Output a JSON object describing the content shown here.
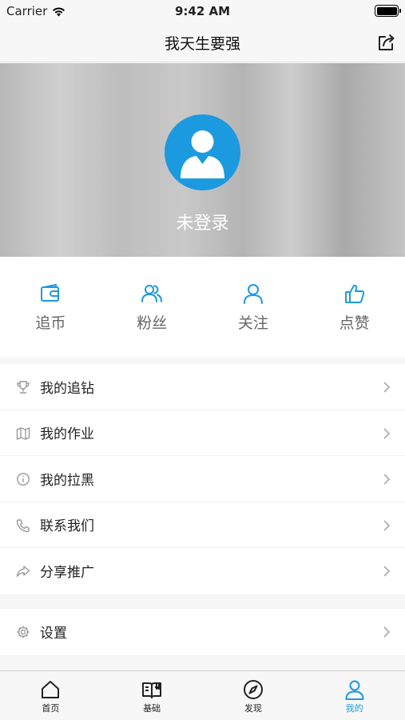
{
  "status_bar": {
    "carrier": "Carrier",
    "time": "9:42 AM"
  },
  "nav": {
    "title": "我天生要强",
    "share_icon": "share-icon"
  },
  "profile": {
    "login_text": "未登录",
    "avatar_icon": "user-avatar-icon"
  },
  "stats": [
    {
      "label": "追币",
      "icon": "wallet-icon"
    },
    {
      "label": "粉丝",
      "icon": "followers-icon"
    },
    {
      "label": "关注",
      "icon": "person-icon"
    },
    {
      "label": "点赞",
      "icon": "thumbs-up-icon"
    }
  ],
  "menu": [
    {
      "label": "我的追钻",
      "icon": "trophy-icon"
    },
    {
      "label": "我的作业",
      "icon": "map-icon"
    },
    {
      "label": "我的拉黑",
      "icon": "info-icon"
    },
    {
      "label": "联系我们",
      "icon": "phone-icon"
    },
    {
      "label": "分享推广",
      "icon": "share-arrow-icon"
    }
  ],
  "settings": {
    "label": "设置",
    "icon": "gear-icon"
  },
  "tabs": [
    {
      "label": "首页",
      "icon": "home-icon",
      "active": false
    },
    {
      "label": "基础",
      "icon": "book-icon",
      "active": false
    },
    {
      "label": "发现",
      "icon": "compass-icon",
      "active": false
    },
    {
      "label": "我的",
      "icon": "profile-icon",
      "active": true
    }
  ],
  "colors": {
    "accent": "#1b9ae0",
    "icon_gray": "#999999"
  }
}
